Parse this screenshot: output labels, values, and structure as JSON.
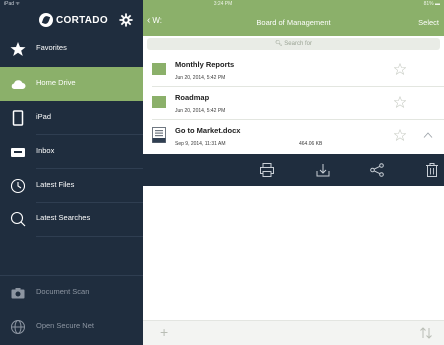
{
  "status": {
    "device": "iPad ᯤ",
    "time": "3:24 PM",
    "battery": "81% ▬"
  },
  "brand": {
    "name": "CORTADO"
  },
  "sidebar": {
    "items": [
      {
        "label": "Favorites",
        "icon": "star-icon"
      },
      {
        "label": "Home Drive",
        "icon": "cloud-icon",
        "active": true
      },
      {
        "label": "iPad",
        "icon": "tablet-icon"
      },
      {
        "label": "Inbox",
        "icon": "inbox-icon"
      },
      {
        "label": "Latest Files",
        "icon": "clock-icon"
      },
      {
        "label": "Latest Searches",
        "icon": "search-icon"
      }
    ],
    "bottom_items": [
      {
        "label": "Document Scan",
        "icon": "camera-icon"
      },
      {
        "label": "Open Secure Net",
        "icon": "globe-icon"
      }
    ]
  },
  "topbar": {
    "back_label": "W:",
    "title": "Board of Management",
    "select_label": "Select"
  },
  "search": {
    "placeholder": "Search for"
  },
  "files": [
    {
      "name": "Monthly Reports",
      "date": "Jun 20, 2014, 5:42 PM",
      "type": "folder",
      "size": ""
    },
    {
      "name": "Roadmap",
      "date": "Jun 20, 2014, 5:42 PM",
      "type": "folder",
      "size": ""
    },
    {
      "name": "Go to Market.docx",
      "date": "Sep 9, 2014, 11:31 AM",
      "type": "document",
      "size": "464.06 KB",
      "expanded": true
    }
  ],
  "actions": [
    "print-icon",
    "download-icon",
    "share-icon",
    "trash-icon"
  ],
  "bottom": {
    "plus": "+",
    "sort_icon": "sort-icon"
  },
  "colors": {
    "sidebar_bg": "#1f2d3e",
    "accent_green": "#8bb06a",
    "folder_green": "#8bb06a"
  }
}
